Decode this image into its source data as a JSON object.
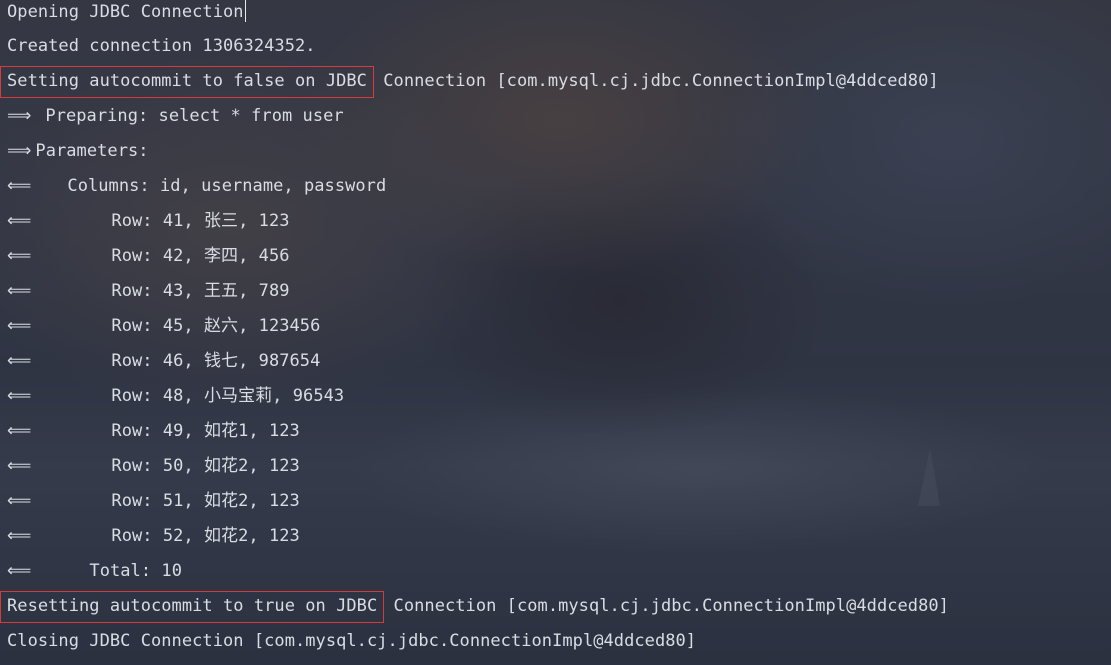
{
  "console": {
    "opening": "Opening JDBC Connection",
    "created": "Created connection 1306324352.",
    "autocommit_false_boxed": "Setting autocommit to false on JDBC",
    "autocommit_false_rest": " Connection [com.mysql.cj.jdbc.ConnectionImpl@4ddced80]",
    "out_arrow": "⟹",
    "in_arrow": "⟸",
    "preparing": "Preparing: select * from user",
    "parameters": "Parameters: ",
    "columns": "Columns: id, username, password",
    "rows": [
      "Row: 41, 张三, 123",
      "Row: 42, 李四, 456",
      "Row: 43, 王五, 789",
      "Row: 45, 赵六, 123456",
      "Row: 46, 钱七, 987654",
      "Row: 48, 小马宝莉, 96543",
      "Row: 49, 如花1, 123",
      "Row: 50, 如花2, 123",
      "Row: 51, 如花2, 123",
      "Row: 52, 如花2, 123"
    ],
    "total": "Total: 10",
    "autocommit_true_boxed": "Resetting autocommit to true on JDBC",
    "autocommit_true_rest": " Connection [com.mysql.cj.jdbc.ConnectionImpl@4ddced80]",
    "closing": "Closing JDBC Connection [com.mysql.cj.jdbc.ConnectionImpl@4ddced80]"
  },
  "colors": {
    "text": "#d9dde3",
    "highlight_box": "#d63a3a"
  }
}
